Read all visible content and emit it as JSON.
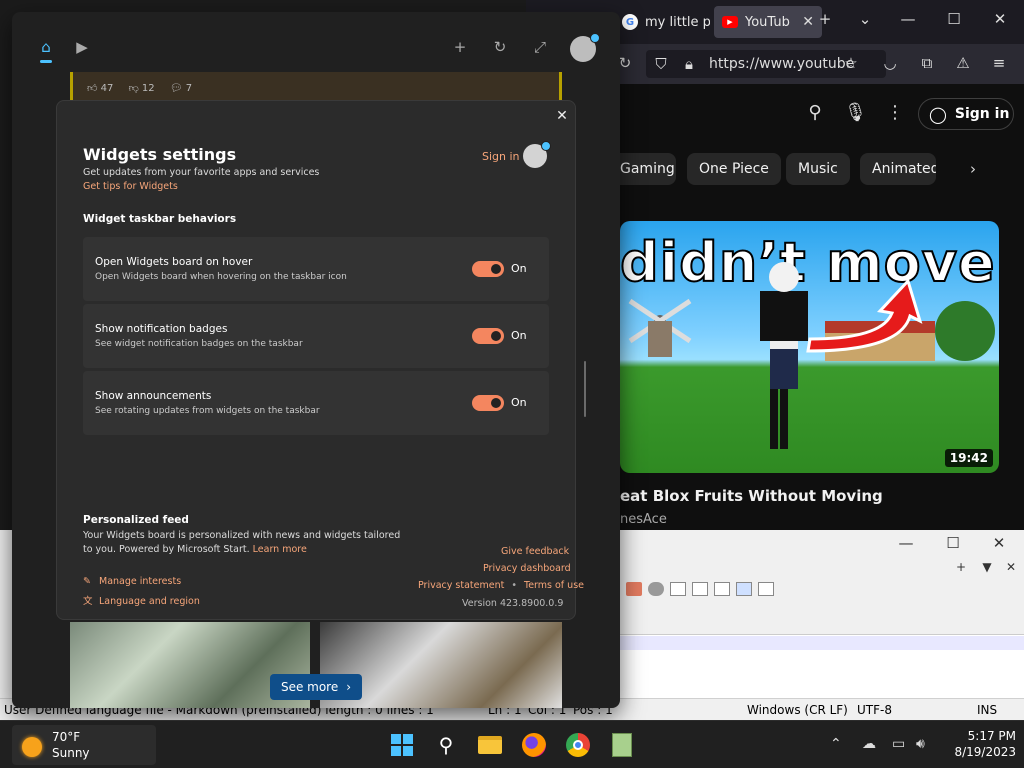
{
  "browser": {
    "tabs": [
      {
        "label": "my little p",
        "icon": "google-icon"
      },
      {
        "label": "YouTub",
        "icon": "youtube-icon"
      }
    ],
    "url": "https://www.youtube",
    "youtube": {
      "signin": "Sign in",
      "chips": [
        "Gaming",
        "One Piece",
        "Music",
        "Animated"
      ],
      "thumbnail_text": "didn’t move",
      "duration": "19:42",
      "video_title": "eat Blox Fruits Without Moving",
      "channel": "nesAce"
    }
  },
  "editor": {
    "status": {
      "lang": "User Defined language file - Markdown (preinstalled) length : 0    lines : 1",
      "ln": "Ln : 1",
      "col": "Col : 1",
      "pos": "Pos : 1",
      "eol": "Windows (CR LF)",
      "encoding": "UTF-8",
      "mode": "INS"
    }
  },
  "taskbar": {
    "weather": {
      "temp": "70°F",
      "condition": "Sunny"
    },
    "time": "5:17 PM",
    "date": "8/19/2023"
  },
  "widgets": {
    "feed_stats": {
      "likes": "47",
      "dislikes": "12",
      "comments": "7"
    },
    "see_more": "See more",
    "settings": {
      "close": "✕",
      "title": "Widgets settings",
      "subtitle": "Get updates from your favorite apps and services",
      "tips_link": "Get tips for Widgets",
      "signin": "Sign in",
      "section_title": "Widget taskbar behaviors",
      "rows": [
        {
          "title": "Open Widgets board on hover",
          "desc": "Open Widgets board when hovering on the taskbar icon",
          "state": "On"
        },
        {
          "title": "Show notification badges",
          "desc": "See widget notification badges on the taskbar",
          "state": "On"
        },
        {
          "title": "Show announcements",
          "desc": "See rotating updates from widgets on the taskbar",
          "state": "On"
        }
      ],
      "feed": {
        "title": "Personalized feed",
        "desc_line1": "Your Widgets board is personalized with news and widgets tailored",
        "desc_line2": "to you. Powered by Microsoft Start.",
        "learn_more": "Learn more",
        "manage_interests": "Manage interests",
        "language_region": "Language and region",
        "give_feedback": "Give feedback",
        "privacy_dashboard": "Privacy dashboard",
        "privacy_statement": "Privacy statement",
        "terms": "Terms of use",
        "version": "Version 423.8900.0.9"
      }
    }
  },
  "colors": {
    "accent": "#f7a67a",
    "toggle_on": "#f4865f",
    "panel_bg": "#2b2b2b",
    "row_bg": "#333333"
  }
}
